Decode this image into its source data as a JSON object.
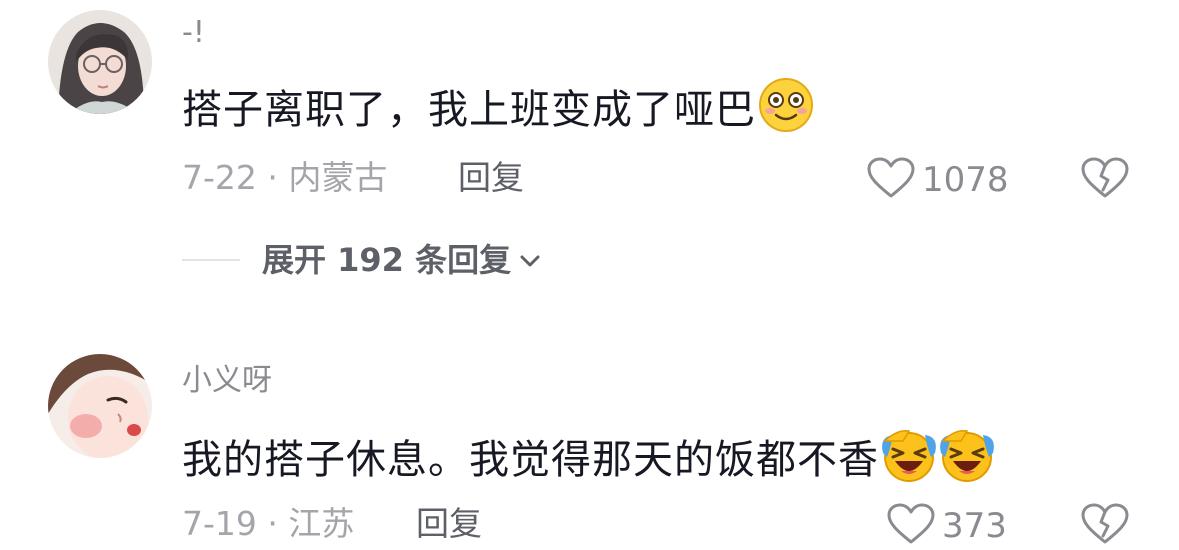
{
  "comments": [
    {
      "username": "-!",
      "text": "搭子离职了，我上班变成了哑巴",
      "emojis": [
        "smiling-face-emoji"
      ],
      "date_location": "7-22 · 内蒙古",
      "reply_label": "回复",
      "likes": "1078"
    },
    {
      "username": "小义呀",
      "text": "我的搭子休息。我觉得那天的饭都不香",
      "emojis": [
        "laughing-crying-emoji",
        "laughing-crying-emoji"
      ],
      "date_location": "7-19 · 江苏",
      "reply_label": "回复",
      "likes": "373"
    }
  ],
  "expand_replies": {
    "label": "展开 192 条回复"
  },
  "colors": {
    "primary_text": "#161823",
    "secondary_text": "#8a8b91",
    "meta_text": "#a4a5aa",
    "action_text": "#5e6068",
    "divider": "#e3e3e6"
  }
}
